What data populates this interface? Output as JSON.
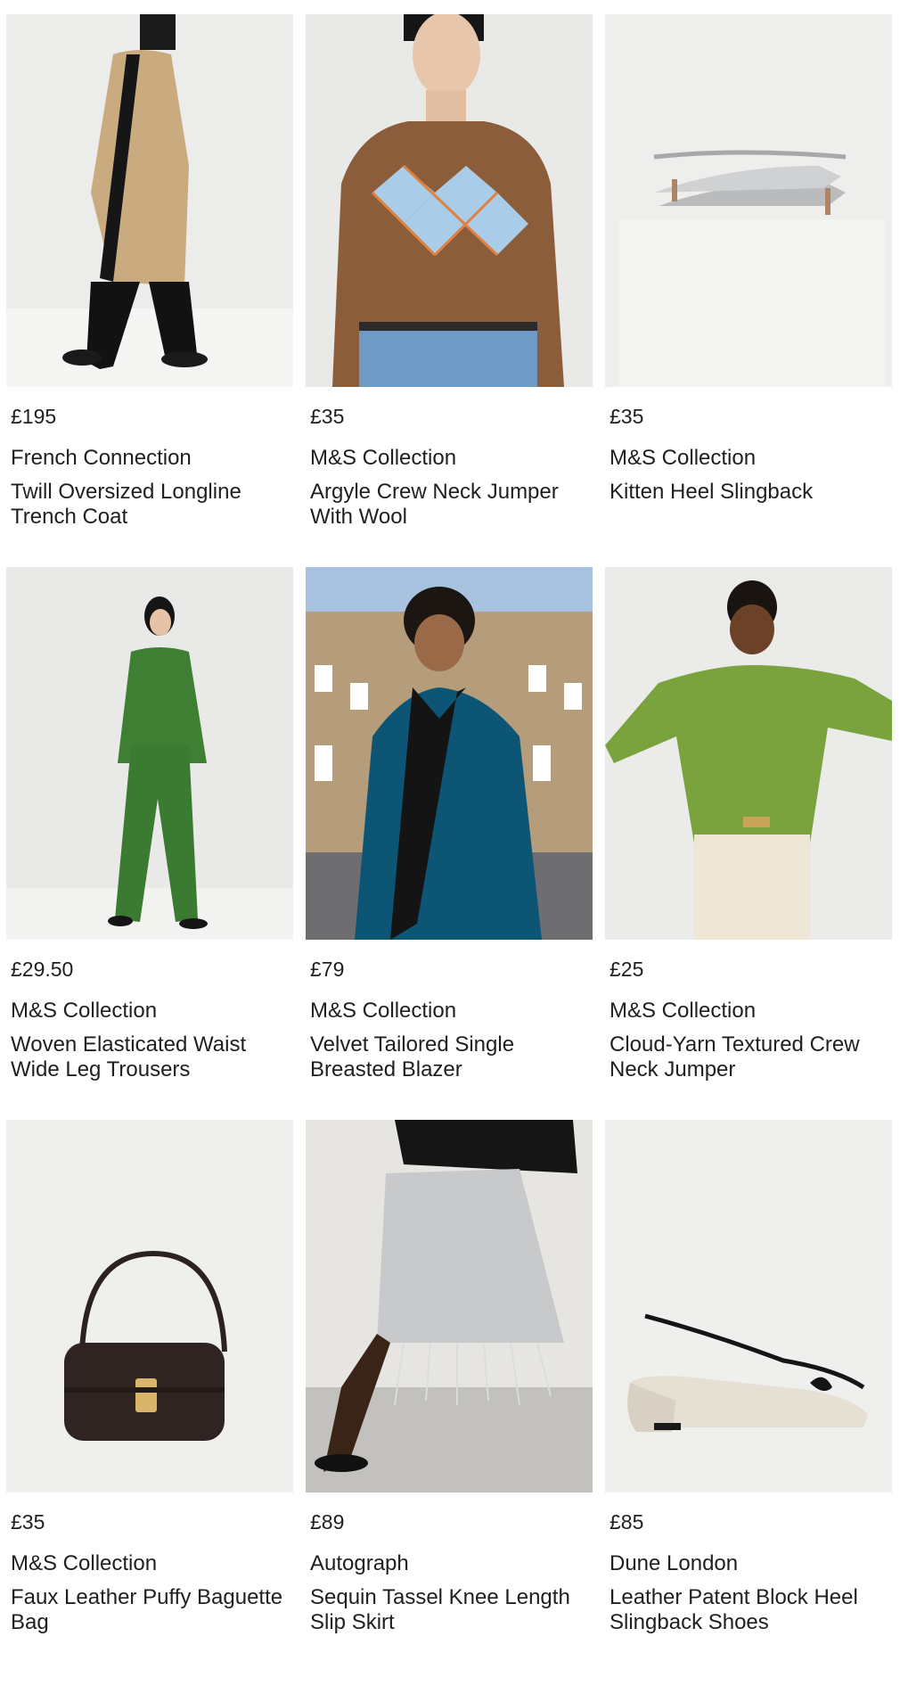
{
  "products": [
    {
      "price": "£195",
      "brand": "French Connection",
      "name": "Twill Oversized Longline Trench Coat",
      "image": "woman-in-beige-trench-coat"
    },
    {
      "price": "£35",
      "brand": "M&S Collection",
      "name": "Argyle Crew Neck Jumper With Wool",
      "image": "woman-in-brown-argyle-jumper"
    },
    {
      "price": "£35",
      "brand": "M&S Collection",
      "name": "Kitten Heel Slingback",
      "image": "silver-kitten-heel-slingbacks"
    },
    {
      "price": "£29.50",
      "brand": "M&S Collection",
      "name": "Woven Elasticated Waist Wide Leg Trousers",
      "image": "woman-in-green-suit"
    },
    {
      "price": "£79",
      "brand": "M&S Collection",
      "name": "Velvet Tailored Single Breasted Blazer",
      "image": "woman-in-teal-velvet-blazer"
    },
    {
      "price": "£25",
      "brand": "M&S Collection",
      "name": "Cloud-Yarn Textured Crew Neck Jumper",
      "image": "woman-in-green-knit-jumper"
    },
    {
      "price": "£35",
      "brand": "M&S Collection",
      "name": "Faux Leather Puffy Baguette Bag",
      "image": "brown-baguette-bag"
    },
    {
      "price": "£89",
      "brand": "Autograph",
      "name": "Sequin Tassel Knee Length Slip Skirt",
      "image": "silver-sequin-tassel-skirt"
    },
    {
      "price": "£85",
      "brand": "Dune London",
      "name": "Leather Patent Block Heel Slingback Shoes",
      "image": "cream-block-heel-slingback"
    }
  ]
}
